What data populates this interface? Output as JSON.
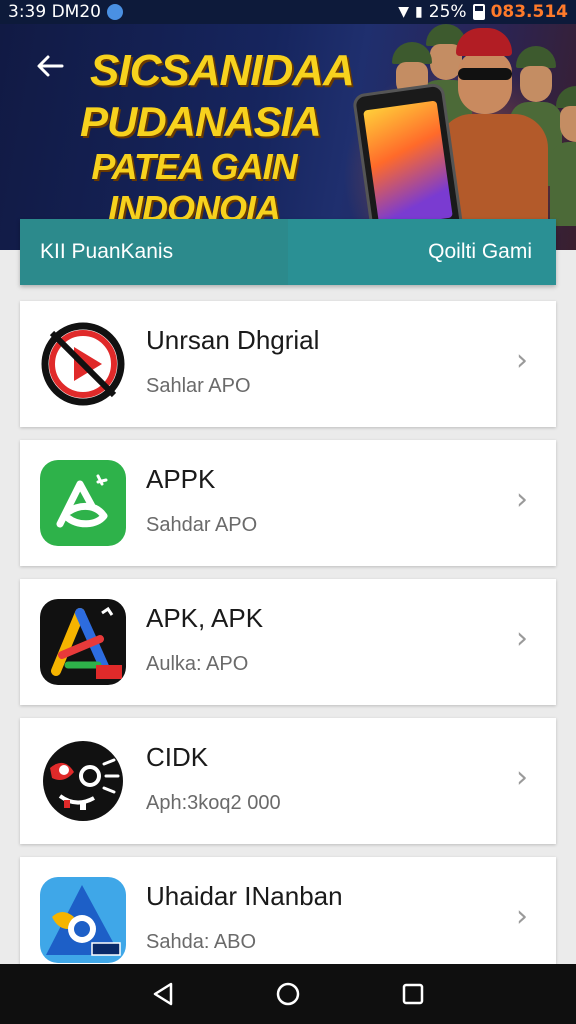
{
  "status_bar": {
    "time": "3:39 DM20",
    "battery_percent": "25%",
    "counter": "083.514"
  },
  "banner": {
    "line1": "SICSANIDAA",
    "line2": "PUDANASIA",
    "line3": "PATEA GAIN INDONOIA"
  },
  "tabs": {
    "left_label": "KII PuanKanis",
    "right_label": "Qoilti Gami"
  },
  "apps": [
    {
      "title": "Unrsan Dhgrial",
      "subtitle": "Sahlar APO",
      "icon": "red-play-icon"
    },
    {
      "title": "APPK",
      "subtitle": "Sahdar APO",
      "icon": "green-a-icon"
    },
    {
      "title": "APK, APK",
      "subtitle": "Aulka: APO",
      "icon": "multicolor-a-icon"
    },
    {
      "title": "CIDK",
      "subtitle": "Aph:3koq2 000",
      "icon": "mask-icon"
    },
    {
      "title": "Uhaidar INanban",
      "subtitle": "Sahda: ABO",
      "icon": "blue-circle-icon"
    }
  ],
  "colors": {
    "tab_header": "#2c8a8c",
    "banner_text": "#f7d21e",
    "card_bg": "#ffffff",
    "nav_bar": "#0f0f0f"
  }
}
